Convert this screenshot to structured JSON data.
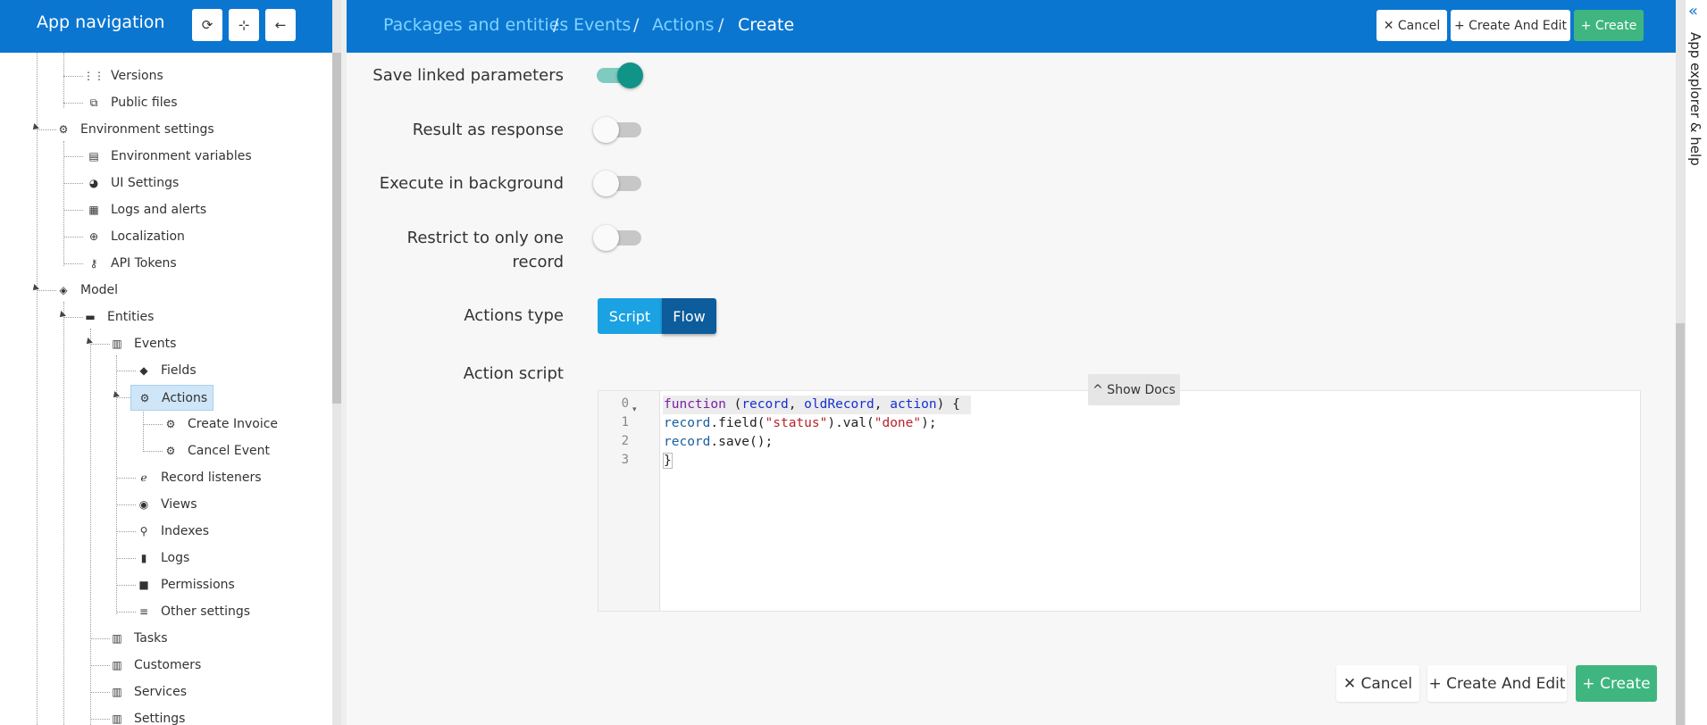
{
  "sidebar": {
    "title": "App navigation",
    "buttons": [
      {
        "name": "refresh-icon",
        "glyph": "⟳"
      },
      {
        "name": "locate-icon",
        "glyph": "⊹"
      },
      {
        "name": "arrow-left-icon",
        "glyph": "←"
      }
    ],
    "tree": [
      {
        "label": "Versions",
        "icon": "grid-icon",
        "glyph": "⋮⋮"
      },
      {
        "label": "Public files",
        "icon": "copy-icon",
        "glyph": "⧉"
      },
      {
        "label": "Environment settings",
        "icon": "settings-box-icon",
        "glyph": "⚙"
      },
      {
        "label": "Environment variables",
        "icon": "clipboard-icon",
        "glyph": "▤"
      },
      {
        "label": "UI Settings",
        "icon": "palette-icon",
        "glyph": "◕"
      },
      {
        "label": "Logs and alerts",
        "icon": "message-icon",
        "glyph": "▦"
      },
      {
        "label": "Localization",
        "icon": "globe-icon",
        "glyph": "⊕"
      },
      {
        "label": "API Tokens",
        "icon": "key-icon",
        "glyph": "⚷"
      },
      {
        "label": "Model",
        "icon": "layers-icon",
        "glyph": "◈"
      },
      {
        "label": "Entities",
        "icon": "folder-icon",
        "glyph": "▬"
      },
      {
        "label": "Events",
        "icon": "library-icon",
        "glyph": "▥"
      },
      {
        "label": "Fields",
        "icon": "tag-icon",
        "glyph": "◆"
      },
      {
        "label": "Actions",
        "icon": "gear-icon",
        "glyph": "⚙"
      },
      {
        "label": "Create Invoice",
        "icon": "gear-icon",
        "glyph": "⚙"
      },
      {
        "label": "Cancel Event",
        "icon": "gear-icon",
        "glyph": "⚙"
      },
      {
        "label": "Record listeners",
        "icon": "ear-icon",
        "glyph": "ℯ"
      },
      {
        "label": "Views",
        "icon": "eye-icon",
        "glyph": "◉"
      },
      {
        "label": "Indexes",
        "icon": "search-icon",
        "glyph": "⚲"
      },
      {
        "label": "Logs",
        "icon": "bookmark-icon",
        "glyph": "▮"
      },
      {
        "label": "Permissions",
        "icon": "lock-icon",
        "glyph": "■"
      },
      {
        "label": "Other settings",
        "icon": "list-icon",
        "glyph": "≡"
      },
      {
        "label": "Tasks",
        "icon": "library-icon",
        "glyph": "▥"
      },
      {
        "label": "Customers",
        "icon": "library-icon",
        "glyph": "▥"
      },
      {
        "label": "Services",
        "icon": "library-icon",
        "glyph": "▥"
      },
      {
        "label": "Settings",
        "icon": "library-icon",
        "glyph": "▥"
      }
    ]
  },
  "header": {
    "breadcrumbs": [
      "Packages and entities",
      "Events",
      "Actions",
      "Create"
    ],
    "separator": "/",
    "cancel": "✕ Cancel",
    "create_and_edit": "+ Create And Edit",
    "create": "+ Create"
  },
  "right_panel": {
    "chevron": "«",
    "label": "App explorer & help"
  },
  "form": {
    "save_linked_parameters": {
      "label": "Save linked parameters",
      "on": true
    },
    "result_as_response": {
      "label": "Result as response",
      "on": false
    },
    "execute_in_background": {
      "label": "Execute in background",
      "on": false
    },
    "restrict_line1": "Restrict to only one",
    "restrict_line2": "record",
    "restrict_on": false,
    "actions_type_label": "Actions type",
    "actions_type_options": [
      "Script",
      "Flow"
    ],
    "actions_type_selected": "Flow",
    "action_script_label": "Action script",
    "show_docs": "^ Show Docs"
  },
  "editor": {
    "line_numbers": [
      "0",
      "1",
      "2",
      "3"
    ],
    "fold_glyph": "▾",
    "line0": {
      "kw": "function",
      "p1": " (",
      "a1": "record",
      "c1": ", ",
      "a2": "oldRecord",
      "c2": ", ",
      "a3": "action",
      "p2": ") {"
    },
    "line1": {
      "obj": "record",
      "m1": ".field(",
      "s1": "\"status\"",
      "m2": ").val(",
      "s2": "\"done\"",
      "m3": ");"
    },
    "line2": {
      "obj": "record",
      "m1": ".save();"
    },
    "line3": "}"
  },
  "footer": {
    "cancel": "✕ Cancel",
    "create_and_edit": "+ Create And Edit",
    "create": "+ Create"
  },
  "colors": {
    "brand": "#0b76d0",
    "breadcrumb_link": "#7fd4ff",
    "success": "#3fb67f",
    "toggle_on": "#119488"
  }
}
